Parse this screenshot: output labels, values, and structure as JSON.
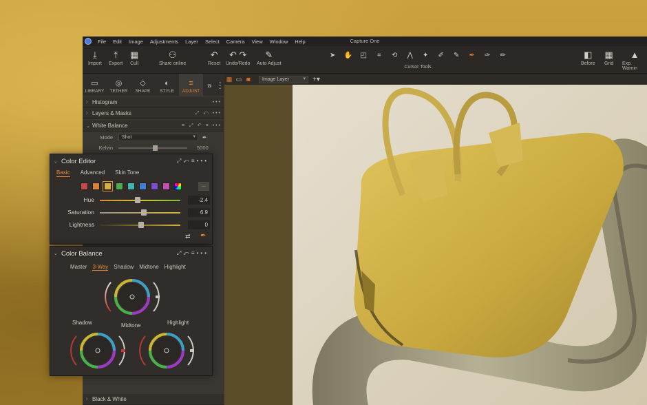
{
  "app": {
    "window_title": "Capture One"
  },
  "menu": [
    "File",
    "Edit",
    "Image",
    "Adjustments",
    "Layer",
    "Select",
    "Camera",
    "View",
    "Window",
    "Help"
  ],
  "toolbar": {
    "import": "Import",
    "export": "Export",
    "cull": "Cull",
    "share_online": "Share online",
    "reset": "Reset",
    "undo_redo": "Undo/Redo",
    "auto_adjust": "Auto Adjust",
    "cursor_tools": "Cursor Tools",
    "before": "Before",
    "grid": "Grid",
    "exp_warning": "Exp. Warnin"
  },
  "tool_tabs": [
    {
      "label": "LIBRARY",
      "icon": "folder-icon"
    },
    {
      "label": "TETHER",
      "icon": "camera-icon"
    },
    {
      "label": "SHAPE",
      "icon": "crop-icon"
    },
    {
      "label": "STYLE",
      "icon": "style-icon"
    },
    {
      "label": "ADJUST",
      "icon": "sliders-icon",
      "active": true
    }
  ],
  "panel": {
    "histogram": "Histogram",
    "layers_masks": "Layers & Masks",
    "white_balance": "White Balance",
    "wb_mode_label": "Mode",
    "wb_mode_value": "Shot",
    "kelvin_label": "Kelvin",
    "kelvin_value": "5000",
    "black_white": "Black & White"
  },
  "viewer": {
    "layer": "Image Layer"
  },
  "color_editor": {
    "title": "Color Editor",
    "tabs": [
      "Basic",
      "Advanced",
      "Skin Tone"
    ],
    "active_tab": "Basic",
    "swatch_colors": [
      "#c44a4a",
      "#d4823a",
      "#d4b23a",
      "#4cae4a",
      "#3fb6b0",
      "#3f7fd4",
      "#7d4fd0",
      "#c44fb0"
    ],
    "more_label": "...",
    "hue_label": "Hue",
    "hue_value": "-2.4",
    "saturation_label": "Saturation",
    "saturation_value": "6.9",
    "lightness_label": "Lightness",
    "lightness_value": "0"
  },
  "color_balance": {
    "title": "Color Balance",
    "tabs": [
      "Master",
      "3-Way",
      "Shadow",
      "Midtone",
      "Highlight"
    ],
    "active_tab": "3-Way",
    "shadow_label": "Shadow",
    "midtone_label": "Midtone",
    "highlight_label": "Highlight"
  },
  "colors": {
    "accent": "#e88a35",
    "panel_bg": "#302d2a"
  }
}
